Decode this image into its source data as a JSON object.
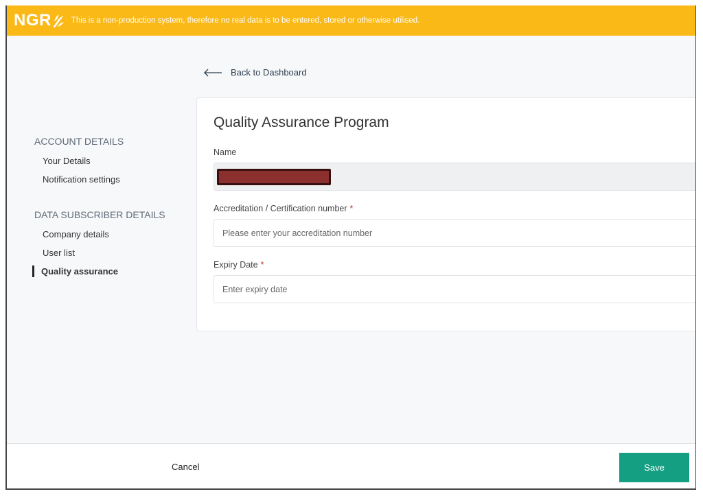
{
  "banner": {
    "logo_text": "NGR",
    "message": "This is a non-production system, therefore no real data is to be entered, stored or otherwise utilised.",
    "color": "#fbb918"
  },
  "back_link": {
    "label": "Back to Dashboard",
    "icon": "arrow-left-icon"
  },
  "sidebar": {
    "sections": [
      {
        "heading": "ACCOUNT DETAILS",
        "items": [
          "Your Details",
          "Notification settings"
        ]
      },
      {
        "heading": "DATA SUBSCRIBER DETAILS",
        "items": [
          "Company details",
          "User list",
          "Quality assurance"
        ]
      }
    ],
    "active_item": "Quality assurance"
  },
  "form": {
    "title": "Quality Assurance Program",
    "name_label": "Name",
    "name_value": "",
    "accreditation_label": "Accreditation / Certification number",
    "accreditation_placeholder": "Please enter your accreditation number",
    "expiry_label": "Expiry Date",
    "expiry_placeholder": "Enter expiry date",
    "required_marker": "*"
  },
  "footer": {
    "cancel_label": "Cancel",
    "save_label": "Save",
    "save_color": "#149f83"
  }
}
